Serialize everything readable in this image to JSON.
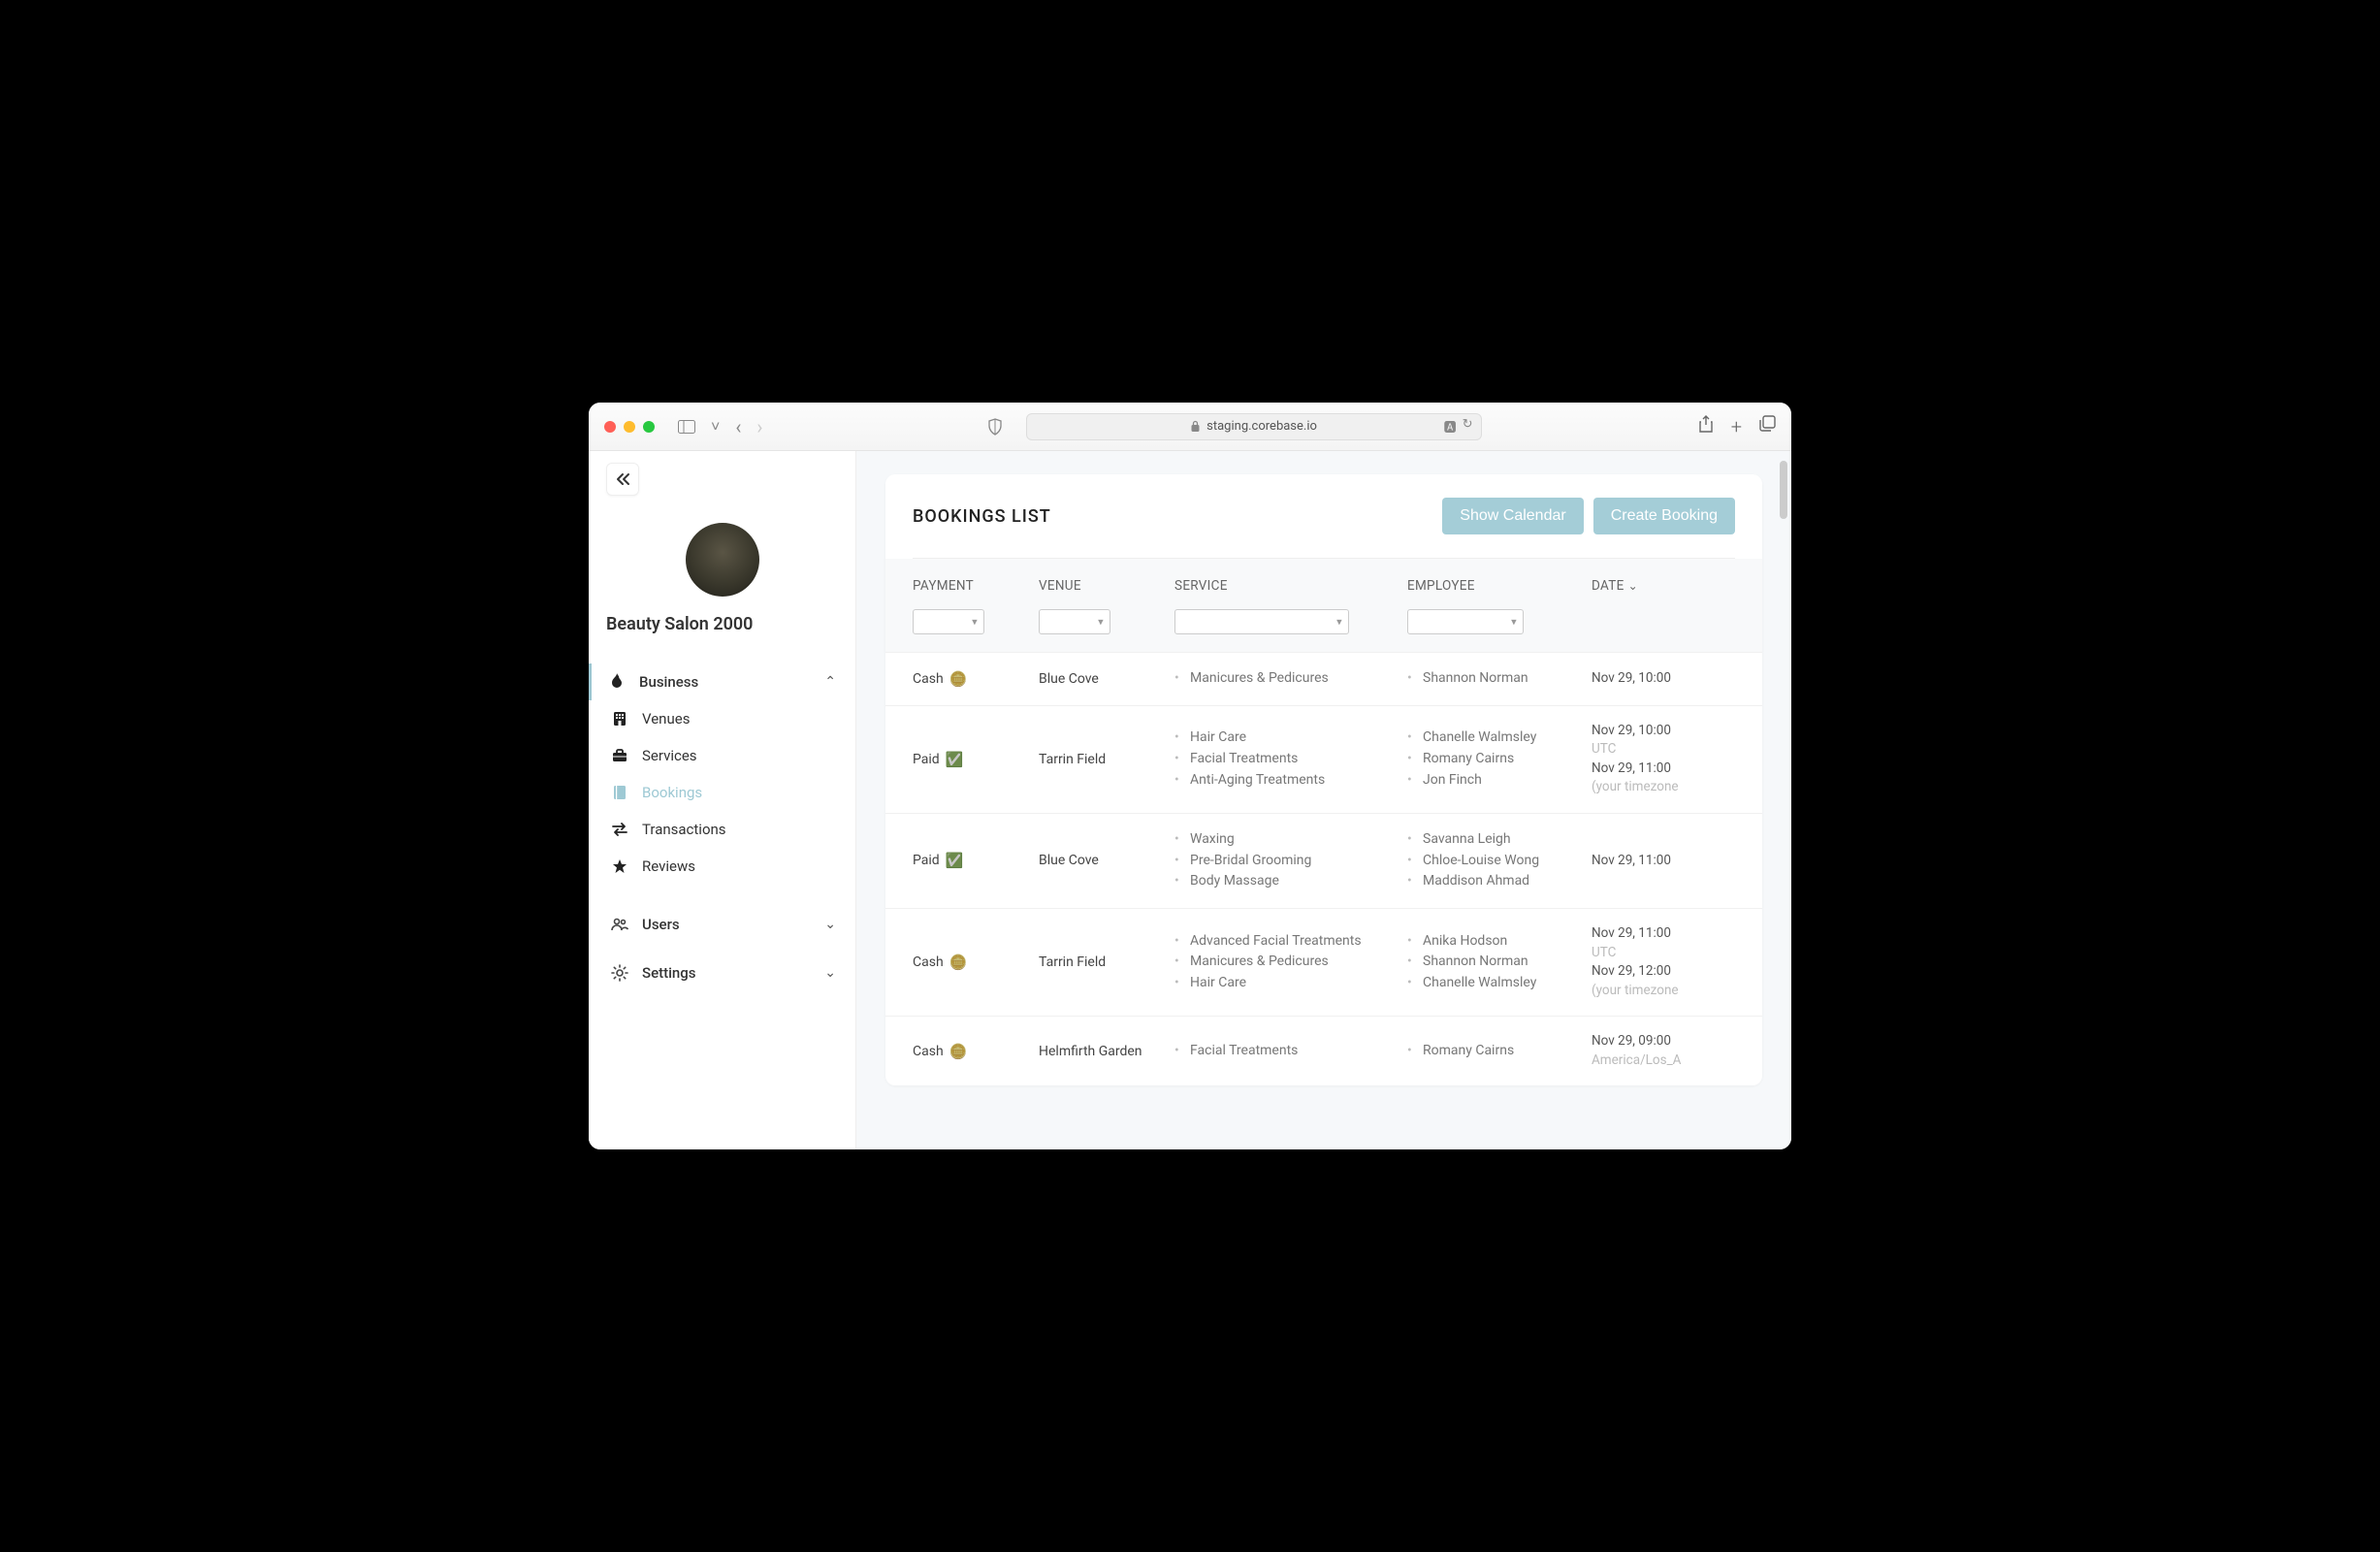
{
  "browser": {
    "url_host": "staging.corebase.io"
  },
  "sidebar": {
    "org_name": "Beauty Salon 2000",
    "sections": {
      "business": {
        "label": "Business"
      },
      "users": {
        "label": "Users"
      },
      "settings": {
        "label": "Settings"
      }
    },
    "items": {
      "venues": "Venues",
      "services": "Services",
      "bookings": "Bookings",
      "transactions": "Transactions",
      "reviews": "Reviews"
    }
  },
  "page": {
    "title": "BOOKINGS LIST",
    "actions": {
      "show_calendar": "Show Calendar",
      "create_booking": "Create Booking"
    }
  },
  "table": {
    "columns": {
      "payment": "PAYMENT",
      "venue": "VENUE",
      "service": "SERVICE",
      "employee": "EMPLOYEE",
      "date": "DATE"
    },
    "rows": [
      {
        "payment": "Cash",
        "payment_symbol": "cash",
        "venue": "Blue Cove",
        "services": [
          "Manicures & Pedicures"
        ],
        "employees": [
          "Shannon Norman"
        ],
        "date_lines": [
          "Nov 29, 10:00"
        ],
        "date_muted": []
      },
      {
        "payment": "Paid",
        "payment_symbol": "check",
        "venue": "Tarrin Field",
        "services": [
          "Hair Care",
          "Facial Treatments",
          "Anti-Aging Treatments"
        ],
        "employees": [
          "Chanelle Walmsley",
          "Romany Cairns",
          "Jon Finch"
        ],
        "date_lines": [
          "Nov 29, 10:00",
          "Nov 29, 11:00"
        ],
        "date_muted": [
          "UTC",
          "(your timezone"
        ]
      },
      {
        "payment": "Paid",
        "payment_symbol": "check",
        "venue": "Blue Cove",
        "services": [
          "Waxing",
          "Pre-Bridal Grooming",
          "Body Massage"
        ],
        "employees": [
          "Savanna Leigh",
          "Chloe-Louise Wong",
          "Maddison Ahmad"
        ],
        "date_lines": [
          "Nov 29, 11:00"
        ],
        "date_muted": []
      },
      {
        "payment": "Cash",
        "payment_symbol": "cash",
        "venue": "Tarrin Field",
        "services": [
          "Advanced Facial Treatments",
          "Manicures & Pedicures",
          "Hair Care"
        ],
        "employees": [
          "Anika Hodson",
          "Shannon Norman",
          "Chanelle Walmsley"
        ],
        "date_lines": [
          "Nov 29, 11:00",
          "Nov 29, 12:00"
        ],
        "date_muted": [
          "UTC",
          "(your timezone"
        ]
      },
      {
        "payment": "Cash",
        "payment_symbol": "cash",
        "venue": "Helmfirth Garden",
        "services": [
          "Facial Treatments"
        ],
        "employees": [
          "Romany Cairns"
        ],
        "date_lines": [
          "Nov 29, 09:00"
        ],
        "date_muted": [
          "America/Los_A"
        ]
      }
    ]
  }
}
